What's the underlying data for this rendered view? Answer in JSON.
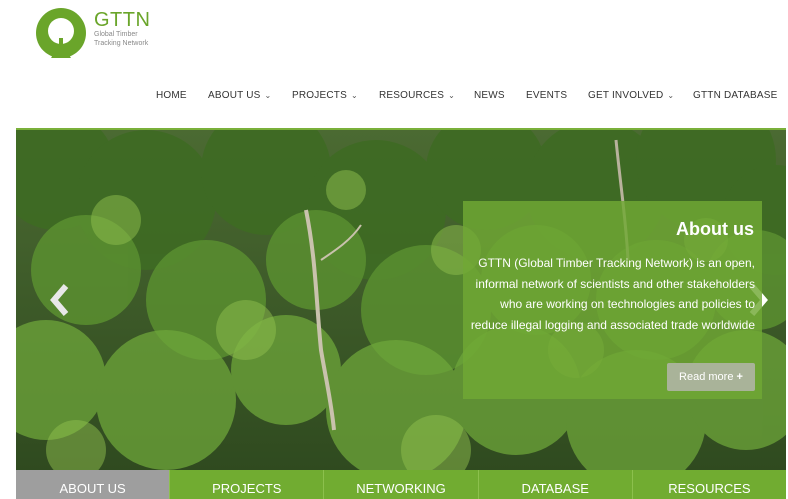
{
  "brand": {
    "title": "GTTN",
    "subtitle_line1": "Global Timber",
    "subtitle_line2": "Tracking Network",
    "color": "#6aa52a"
  },
  "nav": {
    "items": [
      {
        "label": "HOME",
        "dropdown": false
      },
      {
        "label": "ABOUT US",
        "dropdown": true
      },
      {
        "label": "PROJECTS",
        "dropdown": true
      },
      {
        "label": "RESOURCES",
        "dropdown": true
      },
      {
        "label": "NEWS",
        "dropdown": false
      },
      {
        "label": "EVENTS",
        "dropdown": false
      },
      {
        "label": "GET INVOLVED",
        "dropdown": true
      },
      {
        "label": "GTTN DATABASE",
        "dropdown": false
      }
    ],
    "caret": "⌄"
  },
  "slider": {
    "title": "About us",
    "text": "GTTN (Global Timber Tracking Network) is an open, informal network of scientists and other stakeholders who are working on technologies and policies to reduce illegal logging and associated trade worldwide",
    "read_more": "Read more",
    "read_more_icon": "plus-icon",
    "prev_icon": "chevron-left-icon",
    "next_icon": "chevron-right-icon"
  },
  "tabs": [
    {
      "label": "ABOUT US",
      "active": true
    },
    {
      "label": "PROJECTS",
      "active": false
    },
    {
      "label": "NETWORKING",
      "active": false
    },
    {
      "label": "DATABASE",
      "active": false
    },
    {
      "label": "RESOURCES",
      "active": false
    }
  ],
  "colors": {
    "accent": "#71ac31",
    "active_tab": "#9e9e9e"
  }
}
